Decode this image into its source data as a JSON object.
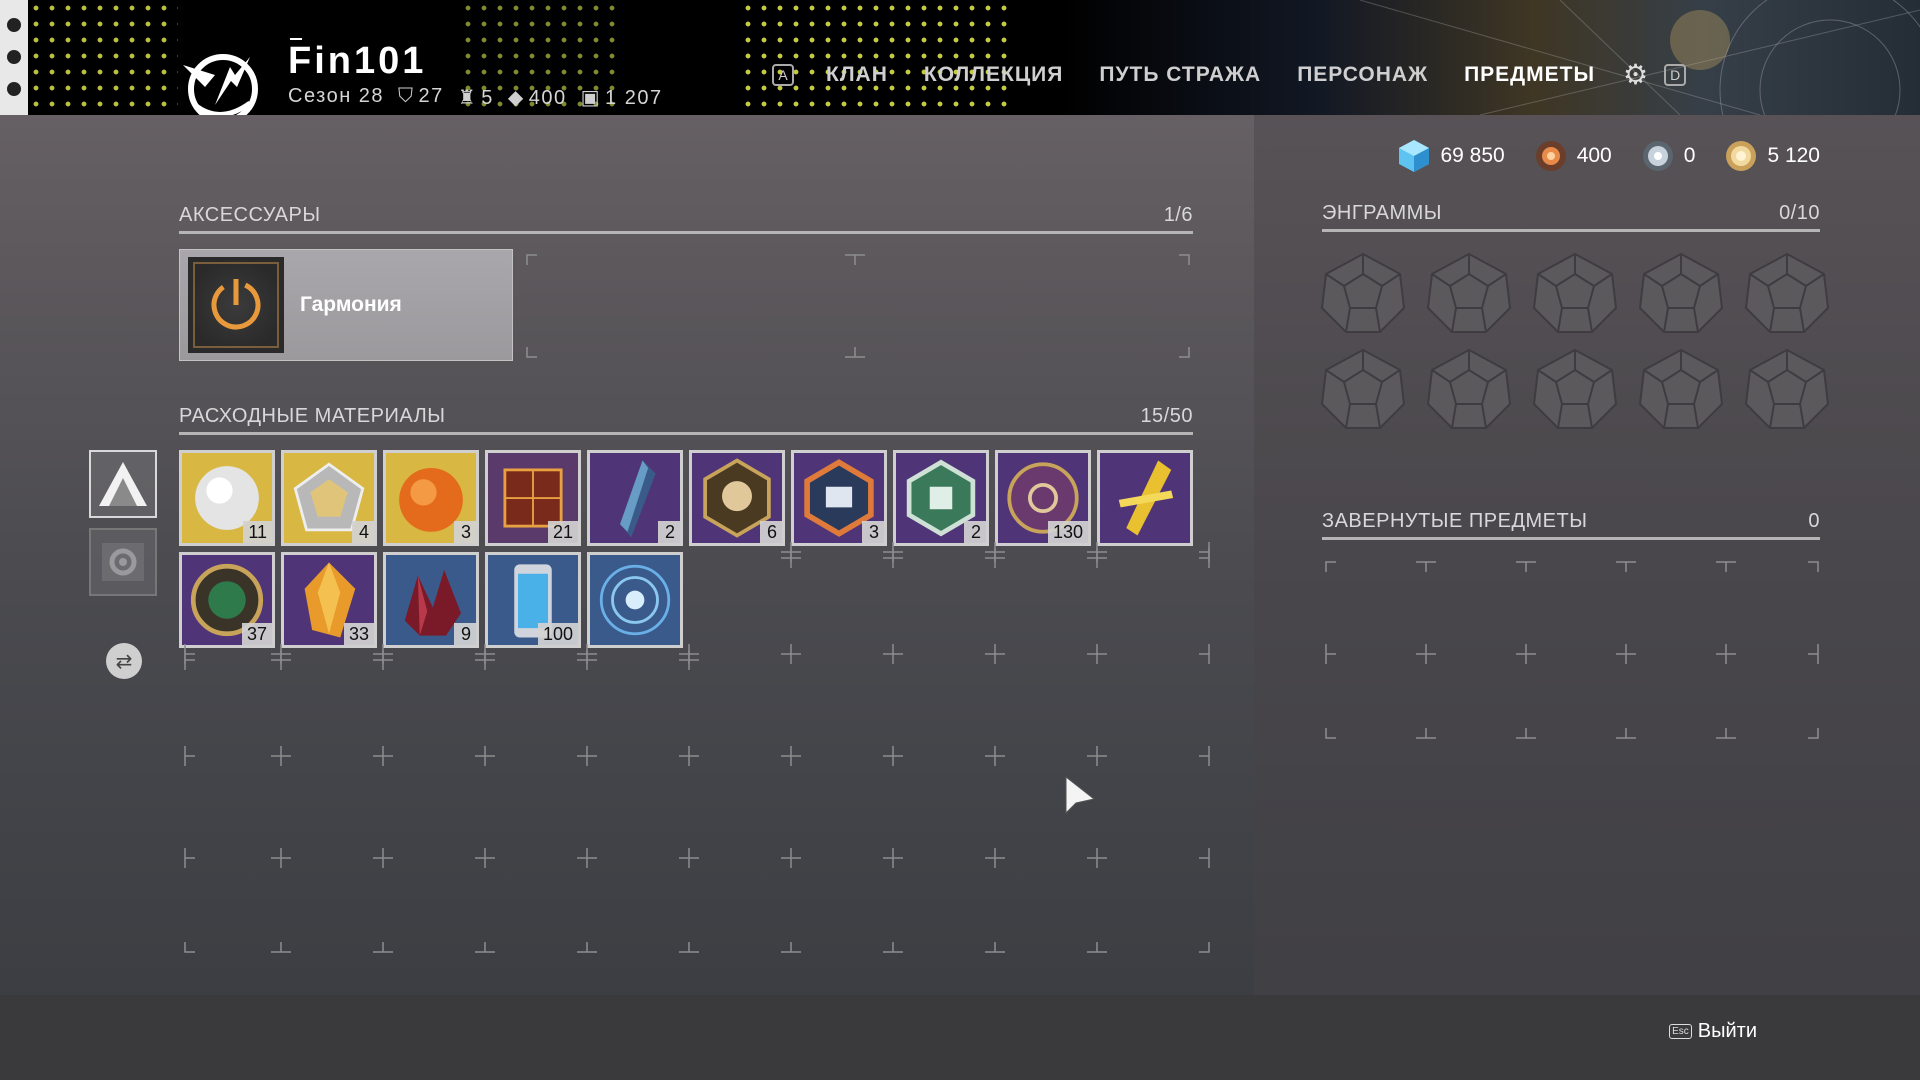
{
  "header": {
    "player_name": "Fin101",
    "stats": {
      "season": "Сезон 28",
      "guardian_rank": "27",
      "triumph": "5",
      "power": "400",
      "score": "1 207"
    },
    "nav_key_left": "A",
    "nav_key_right": "D",
    "tabs": [
      {
        "label": "КЛАН",
        "active": false
      },
      {
        "label": "КОЛЛЕКЦИЯ",
        "active": false
      },
      {
        "label": "ПУТЬ СТРАЖА",
        "active": false
      },
      {
        "label": "ПЕРСОНАЖ",
        "active": false
      },
      {
        "label": "ПРЕДМЕТЫ",
        "active": true
      }
    ],
    "settings_icon": "gear-icon"
  },
  "currencies": [
    {
      "name": "glimmer",
      "icon": "blue-cube-icon",
      "value": "69 850"
    },
    {
      "name": "bright-dust",
      "icon": "orange-dust-icon",
      "value": "400"
    },
    {
      "name": "silver",
      "icon": "silver-icon",
      "value": "0"
    },
    {
      "name": "strange-coin",
      "icon": "gold-coin-icon",
      "value": "5 120"
    }
  ],
  "accessories": {
    "title": "АКСЕССУАРЫ",
    "count": "1/6",
    "items": [
      {
        "name": "Гармония",
        "icon": "power-icon"
      }
    ]
  },
  "consumables": {
    "title": "РАСХОДНЫЕ МАТЕРИАЛЫ",
    "count": "15/50",
    "items": [
      {
        "icon": "white-orb-icon",
        "count": "11",
        "bg": "#d8b842"
      },
      {
        "icon": "silver-pentagon-icon",
        "count": "4",
        "bg": "#d8b842"
      },
      {
        "icon": "orange-orb-icon",
        "count": "3",
        "bg": "#d8b842"
      },
      {
        "icon": "red-cube-icon",
        "count": "21",
        "bg": "#5a3a6a"
      },
      {
        "icon": "blue-shard-icon",
        "count": "2",
        "bg": "#4f3578"
      },
      {
        "icon": "skull-badge-icon",
        "count": "6",
        "bg": "#4f3578"
      },
      {
        "icon": "orange-hex-badge-icon",
        "count": "3",
        "bg": "#4f3578"
      },
      {
        "icon": "green-hex-badge-icon",
        "count": "2",
        "bg": "#4f3578"
      },
      {
        "icon": "purple-coin-icon",
        "count": "130",
        "bg": "#4f3578"
      },
      {
        "icon": "gold-shard-icon",
        "count": "",
        "bg": "#4f3578"
      },
      {
        "icon": "green-gem-ring-icon",
        "count": "37",
        "bg": "#4f3578"
      },
      {
        "icon": "amber-crystal-icon",
        "count": "33",
        "bg": "#4f3578"
      },
      {
        "icon": "red-crystal-icon",
        "count": "9",
        "bg": "#3a5a8c"
      },
      {
        "icon": "blue-canister-icon",
        "count": "100",
        "bg": "#3a5a8c"
      },
      {
        "icon": "blue-rings-icon",
        "count": "",
        "bg": "#3a5a8c"
      }
    ]
  },
  "side_tabs": [
    {
      "icon": "triangle-icon",
      "active": true
    },
    {
      "icon": "gear-ticket-icon",
      "active": false
    },
    {
      "icon": "transfer-icon",
      "active": false
    }
  ],
  "engrams": {
    "title": "ЭНГРАММЫ",
    "count": "0/10"
  },
  "wrapped": {
    "title": "ЗАВЕРНУТЫЕ ПРЕДМЕТЫ",
    "count": "0"
  },
  "footer": {
    "esc_key": "Esc",
    "exit_label": "Выйти"
  }
}
